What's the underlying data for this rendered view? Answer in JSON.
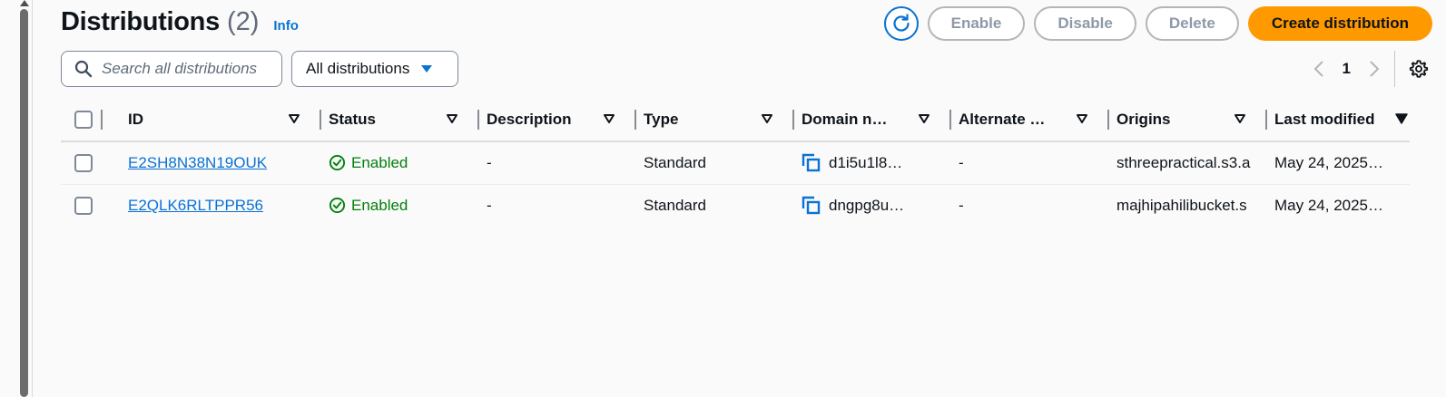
{
  "header": {
    "title": "Distributions",
    "count": "(2)",
    "info_label": "Info"
  },
  "actions": {
    "refresh_icon": "refresh-icon",
    "enable_label": "Enable",
    "disable_label": "Disable",
    "delete_label": "Delete",
    "create_label": "Create distribution",
    "primary_color": "#ff9900"
  },
  "search": {
    "placeholder": "Search all distributions",
    "value": ""
  },
  "filter": {
    "selected": "All distributions"
  },
  "pagination": {
    "current_page": "1"
  },
  "table": {
    "columns": [
      {
        "key": "id",
        "label": "ID"
      },
      {
        "key": "status",
        "label": "Status"
      },
      {
        "key": "description",
        "label": "Description"
      },
      {
        "key": "type",
        "label": "Type"
      },
      {
        "key": "domain",
        "label": "Domain n…"
      },
      {
        "key": "alternate",
        "label": "Alternate …"
      },
      {
        "key": "origins",
        "label": "Origins"
      },
      {
        "key": "last_modified",
        "label": "Last modified"
      }
    ],
    "sorted_column": "last_modified",
    "rows": [
      {
        "id": "E2SH8N38N19OUK",
        "status": "Enabled",
        "description": "-",
        "type": "Standard",
        "domain": "d1i5u1l8…",
        "alternate": "-",
        "origins": "sthreepractical.s3.a",
        "last_modified": "May 24, 2025…"
      },
      {
        "id": "E2QLK6RLTPPR56",
        "status": "Enabled",
        "description": "-",
        "type": "Standard",
        "domain": "dngpg8u…",
        "alternate": "-",
        "origins": "majhipahilibucket.s",
        "last_modified": "May 24, 2025…"
      }
    ]
  },
  "colors": {
    "link": "#0972d3",
    "success": "#037f0c"
  }
}
